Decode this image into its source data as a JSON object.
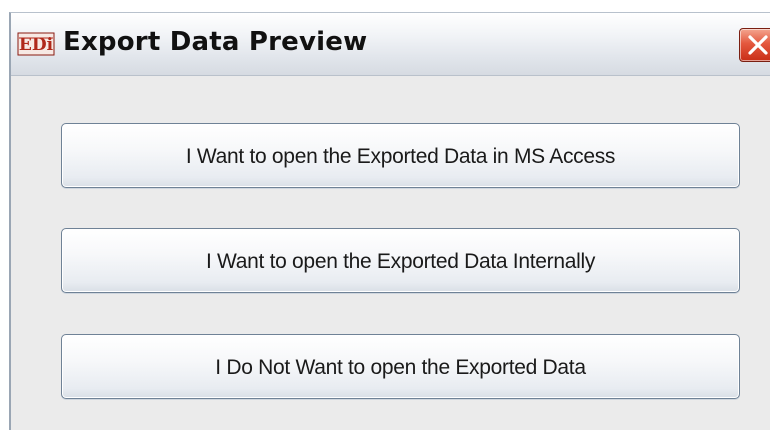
{
  "window": {
    "title": "Export Data Preview",
    "icon": "ebi-app-icon",
    "close_icon": "close-x-icon"
  },
  "buttons": [
    {
      "label": "I Want to open the Exported Data in MS Access"
    },
    {
      "label": "I Want to open the Exported Data Internally"
    },
    {
      "label": "I Do Not Want to open the Exported Data"
    }
  ],
  "colors": {
    "close_button": "#d9452b",
    "icon_red": "#b0281a",
    "button_border": "#6f8296"
  }
}
